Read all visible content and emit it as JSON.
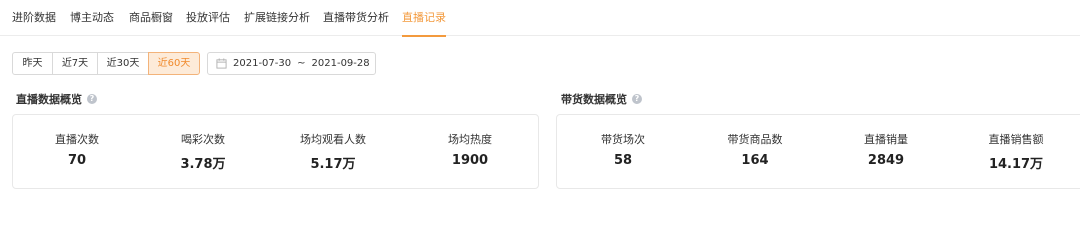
{
  "tabs": [
    {
      "label": "进阶数据"
    },
    {
      "label": "博主动态"
    },
    {
      "label": "商品橱窗"
    },
    {
      "label": "投放评估"
    },
    {
      "label": "扩展链接分析"
    },
    {
      "label": "直播带货分析"
    },
    {
      "label": "直播记录"
    }
  ],
  "active_tab": "直播记录",
  "periods": [
    {
      "label": "昨天"
    },
    {
      "label": "近7天"
    },
    {
      "label": "近30天"
    },
    {
      "label": "近60天"
    }
  ],
  "active_period": "近60天",
  "date_range": {
    "start": "2021-07-30",
    "separator": "~",
    "end": "2021-09-28",
    "icon": "calendar-icon"
  },
  "live_overview": {
    "title": "直播数据概览",
    "metrics": [
      {
        "label": "直播次数",
        "value": "70"
      },
      {
        "label": "喝彩次数",
        "value": "3.78万"
      },
      {
        "label": "场均观看人数",
        "value": "5.17万"
      },
      {
        "label": "场均热度",
        "value": "1900"
      }
    ]
  },
  "sales_overview": {
    "title": "带货数据概览",
    "metrics": [
      {
        "label": "带货场次",
        "value": "58"
      },
      {
        "label": "带货商品数",
        "value": "164"
      },
      {
        "label": "直播销量",
        "value": "2849"
      },
      {
        "label": "直播销售额",
        "value": "14.17万"
      }
    ]
  },
  "colors": {
    "accent": "#f39a3d",
    "active_bg": "#fdebd9",
    "help_icon": "#bfc4cc"
  }
}
